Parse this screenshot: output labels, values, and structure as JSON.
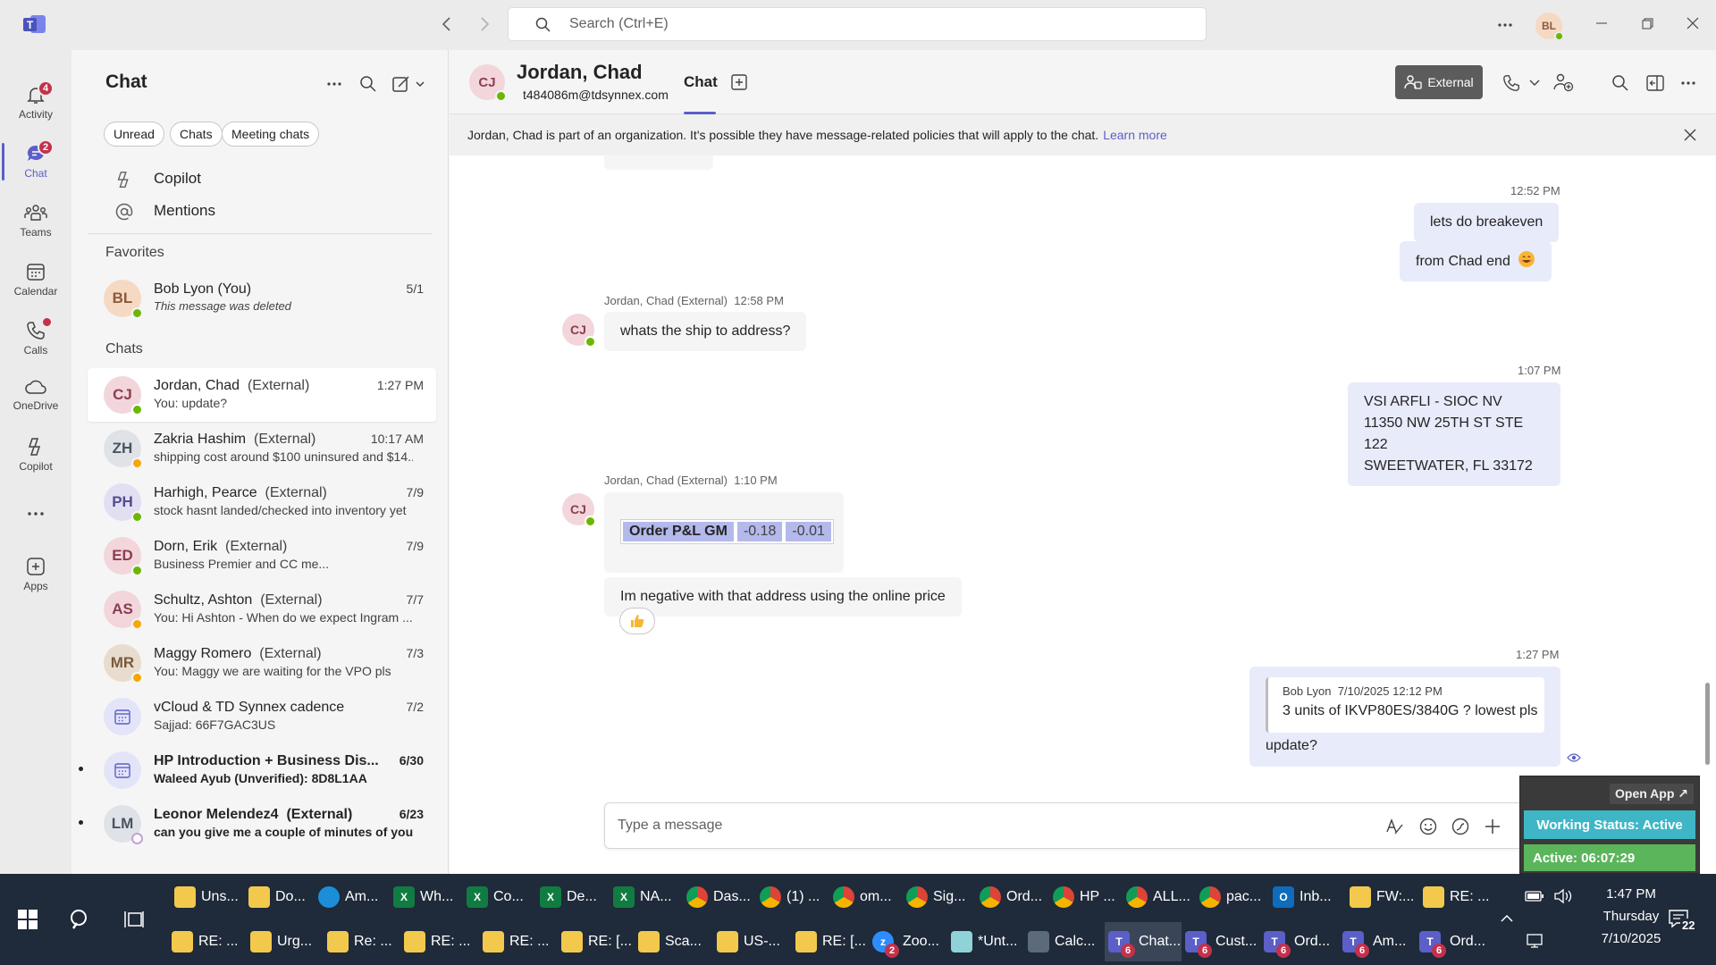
{
  "titlebar": {
    "search_placeholder": "Search (Ctrl+E)",
    "user_initials": "BL"
  },
  "rail": {
    "items": [
      {
        "label": "Activity",
        "badge": "4"
      },
      {
        "label": "Chat",
        "badge": "2"
      },
      {
        "label": "Teams"
      },
      {
        "label": "Calendar"
      },
      {
        "label": "Calls"
      },
      {
        "label": "OneDrive"
      },
      {
        "label": "Copilot"
      },
      {
        "label": "Apps"
      }
    ]
  },
  "list": {
    "title": "Chat",
    "filters": [
      "Unread",
      "Chats",
      "Meeting chats"
    ],
    "copilot_label": "Copilot",
    "mentions_label": "Mentions",
    "favorites_label": "Favorites",
    "favorites": [
      {
        "initials": "BL",
        "name": "Bob Lyon (You)",
        "preview": "This message was deleted",
        "time": "5/1"
      }
    ],
    "chats_label": "Chats",
    "chats": [
      {
        "initials": "CJ",
        "name": "Jordan, Chad",
        "tag": "(External)",
        "preview": "You: update?",
        "time": "1:27 PM"
      },
      {
        "initials": "ZH",
        "name": "Zakria Hashim",
        "tag": "(External)",
        "preview": "shipping cost around $100 uninsured and $14...",
        "time": "10:17 AM"
      },
      {
        "initials": "PH",
        "name": "Harhigh, Pearce",
        "tag": "(External)",
        "preview": "stock hasnt landed/checked into inventory yet",
        "time": "7/9"
      },
      {
        "initials": "ED",
        "name": "Dorn, Erik",
        "tag": "(External)",
        "preview": "Business Premier and CC me...",
        "time": "7/9"
      },
      {
        "initials": "AS",
        "name": "Schultz, Ashton",
        "tag": "(External)",
        "preview": "You: Hi Ashton -  When do we expect Ingram ...",
        "time": "7/7"
      },
      {
        "initials": "MR",
        "name": "Maggy Romero",
        "tag": "(External)",
        "preview": "You: Maggy we are waiting for the VPO pls",
        "time": "7/3"
      },
      {
        "initials": "",
        "name": "vCloud & TD Synnex cadence",
        "tag": "",
        "preview": "Sajjad: 66F7GAC3US",
        "time": "7/2"
      },
      {
        "initials": "",
        "name": "HP Introduction + Business Dis...",
        "tag": "",
        "preview": "Waleed Ayub (Unverified): 8D8L1AA",
        "time": "6/30"
      },
      {
        "initials": "LM",
        "name": "Leonor Melendez4",
        "tag": "(External)",
        "preview": "can you give me a couple of minutes of your...",
        "time": "6/23"
      }
    ]
  },
  "header": {
    "initials": "CJ",
    "name": "Jordan, Chad",
    "email": "t484086m@tdsynnex.com",
    "tab_chat": "Chat",
    "external_label": "External"
  },
  "banner": {
    "text": "Jordan, Chad is part of an organization. It's possible they have message-related policies that will apply to the chat.",
    "link": "Learn more"
  },
  "messages": {
    "t1": "12:52 PM",
    "m1": "lets do breakeven",
    "m2": "from Chad end",
    "s1": "Jordan, Chad (External)",
    "s1_time": "12:58 PM",
    "m3": "whats the ship to address?",
    "t2": "1:07 PM",
    "addr1": "VSI ARFLI - SIOC NV",
    "addr2": "11350 NW 25TH ST STE 122",
    "addr3": "SWEETWATER, FL 33172",
    "s2": "Jordan, Chad (External)",
    "s2_time": "1:10 PM",
    "pl_label": "Order P&L GM",
    "pl_v1": "-0.18",
    "pl_v2": "-0.01",
    "m4": "Im negative with that address using the online price",
    "t3": "1:27 PM",
    "quote_author": "Bob Lyon",
    "quote_time": "7/10/2025 12:12 PM",
    "quote_text": "3 units of IKVP80ES/3840G ? lowest pls",
    "m5": "update?"
  },
  "compose": {
    "placeholder": "Type a message"
  },
  "widget": {
    "open_app": "Open App ↗",
    "status": "Working Status: Active",
    "timer": "Active: 06:07:29"
  },
  "taskbar": {
    "row1": [
      "Uns...",
      "Do...",
      "Am...",
      "Wh...",
      "Co...",
      "De...",
      "NA...",
      "Das...",
      "(1) ...",
      "om...",
      "Sig...",
      "Ord...",
      "HP ...",
      "ALL...",
      "pac...",
      "Inb...",
      "FW:...",
      "RE: ..."
    ],
    "row2": [
      "RE: ...",
      "Urg...",
      "Re: ...",
      "RE: ...",
      "RE: ...",
      "RE: [...",
      "Sca...",
      "US-...",
      "RE: [...",
      "Zoo...",
      "*Unt...",
      "Calc...",
      "Chat...",
      "Cust...",
      "Ord...",
      "Am...",
      "Ord..."
    ],
    "time": "1:47 PM",
    "day": "Thursday",
    "date": "7/10/2025",
    "notif": "22",
    "zoom_badge": "2",
    "teams_badge": "6"
  },
  "colors": {
    "accent": "#5b5fc7",
    "bubble_out": "#e8ebfa",
    "presence_available": "#6bb700",
    "widget_green": "#5bb55b",
    "widget_teal": "#3fb6c6"
  }
}
